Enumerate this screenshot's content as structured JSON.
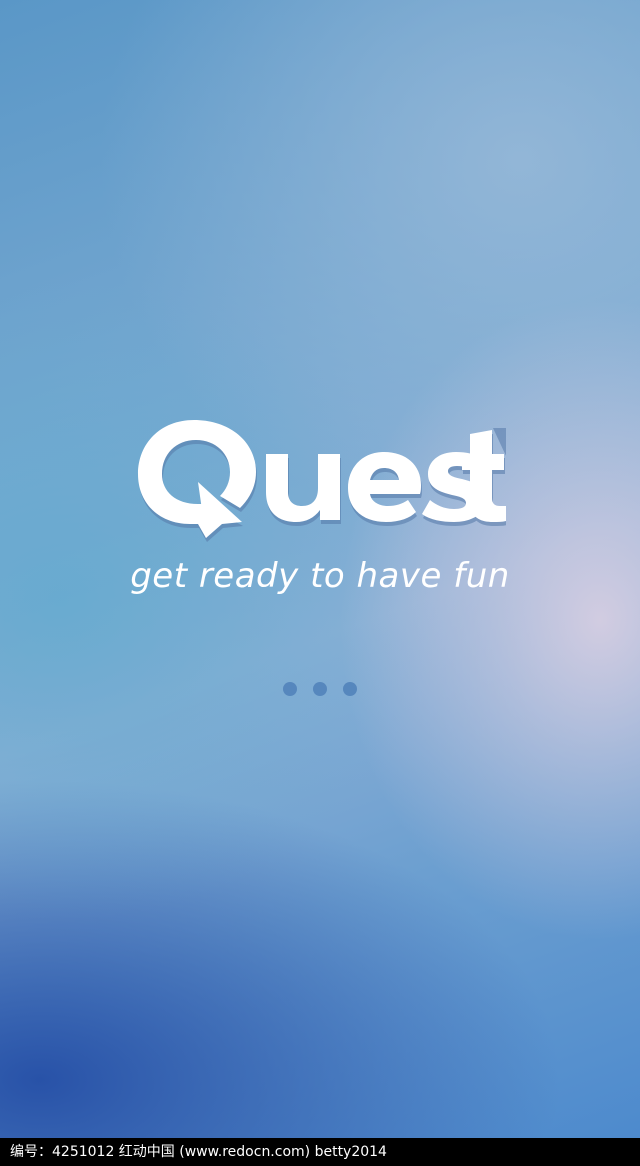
{
  "splash": {
    "app_name": "Quest",
    "tagline": "get ready to have fun",
    "loading_dots": [
      {
        "id": "dot-1"
      },
      {
        "id": "dot-2"
      },
      {
        "id": "dot-3"
      }
    ]
  },
  "watermark": {
    "text": "编号：4251012    红动中国 (www.redocn.com)    betty2014"
  },
  "colors": {
    "logo_fill": "#ffffff",
    "logo_shadow": "#5579a8",
    "dot": "#4f80b9",
    "watermark_bg": "#000000"
  }
}
